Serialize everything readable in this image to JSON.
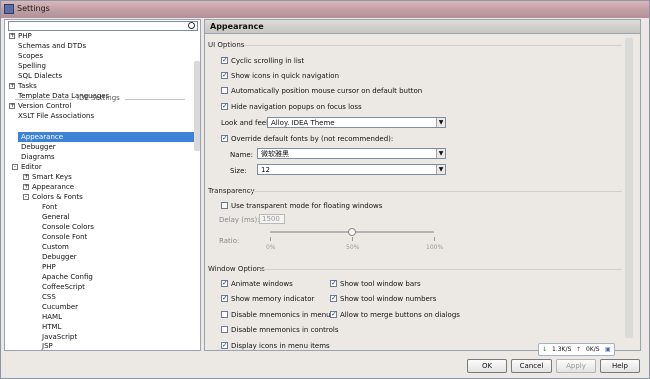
{
  "window": {
    "title": "Settings"
  },
  "search": {
    "placeholder": ""
  },
  "tree": {
    "items": [
      {
        "label": "PHP",
        "expander": "+"
      },
      {
        "label": "Schemas and DTDs"
      },
      {
        "label": "Scopes"
      },
      {
        "label": "Spelling"
      },
      {
        "label": "SQL Dialects"
      },
      {
        "label": "Tasks",
        "expander": "+"
      },
      {
        "label": "Template Data Languages"
      },
      {
        "label": "Version Control",
        "expander": "+"
      },
      {
        "label": "XSLT File Associations"
      }
    ],
    "ide_settings_label": "IDE Settings",
    "ide_items": [
      {
        "label": "Appearance",
        "selected": true
      },
      {
        "label": "Debugger"
      },
      {
        "label": "Diagrams"
      },
      {
        "label": "Editor",
        "expander": "-"
      }
    ],
    "editor_children": [
      {
        "label": "Smart Keys",
        "expander": "+"
      },
      {
        "label": "Appearance",
        "expander": "+"
      },
      {
        "label": "Colors & Fonts",
        "expander": "-"
      }
    ],
    "colors_fonts_children": [
      "Font",
      "General",
      "Console Colors",
      "Console Font",
      "Custom",
      "Debugger",
      "PHP",
      "Apache Config",
      "CoffeeScript",
      "CSS",
      "Cucumber",
      "HAML",
      "HTML",
      "JavaScript",
      "JSP"
    ]
  },
  "panel": {
    "header": "Appearance",
    "ui_options": {
      "label": "UI Options",
      "cyclic_scrolling": {
        "label": "Cyclic scrolling in list",
        "checked": true
      },
      "show_icons": {
        "label": "Show icons in quick navigation",
        "checked": true
      },
      "auto_position": {
        "label": "Automatically position mouse cursor on default button",
        "checked": false
      },
      "hide_nav_popups": {
        "label": "Hide navigation popups on focus loss",
        "checked": true
      },
      "look_and_feel_label": "Look and feel:",
      "look_and_feel_value": "Alloy. IDEA Theme",
      "override_fonts": {
        "label": "Override default fonts by (not recommended):",
        "checked": true
      },
      "name_label": "Name:",
      "name_value": "微软雅黑",
      "size_label": "Size:",
      "size_value": "12"
    },
    "transparency": {
      "label": "Transparency",
      "use_transparent": {
        "label": "Use transparent mode for floating windows",
        "checked": false
      },
      "delay_label": "Delay (ms):",
      "delay_value": "1500",
      "ratio_label": "Ratio:",
      "ratio_ticks": [
        "0%",
        "50%",
        "100%"
      ],
      "ratio_value_percent": 50
    },
    "window_options": {
      "label": "Window Options",
      "animate_windows": {
        "label": "Animate windows",
        "checked": true
      },
      "show_memory": {
        "label": "Show memory indicator",
        "checked": true
      },
      "disable_mnemonics_menu": {
        "label": "Disable mnemonics in menu",
        "checked": false
      },
      "disable_mnemonics_controls": {
        "label": "Disable mnemonics in controls",
        "checked": false
      },
      "display_icons_menu": {
        "label": "Display icons in menu items",
        "checked": true
      },
      "show_tool_window_bars": {
        "label": "Show tool window bars",
        "checked": true
      },
      "show_tool_window_numbers": {
        "label": "Show tool window numbers",
        "checked": true
      },
      "allow_merge_buttons": {
        "label": "Allow to merge buttons on dialogs",
        "checked": true
      }
    }
  },
  "status": {
    "down": "1.3K/S",
    "up": "0K/S"
  },
  "buttons": {
    "ok": "OK",
    "cancel": "Cancel",
    "apply": "Apply",
    "help": "Help"
  }
}
